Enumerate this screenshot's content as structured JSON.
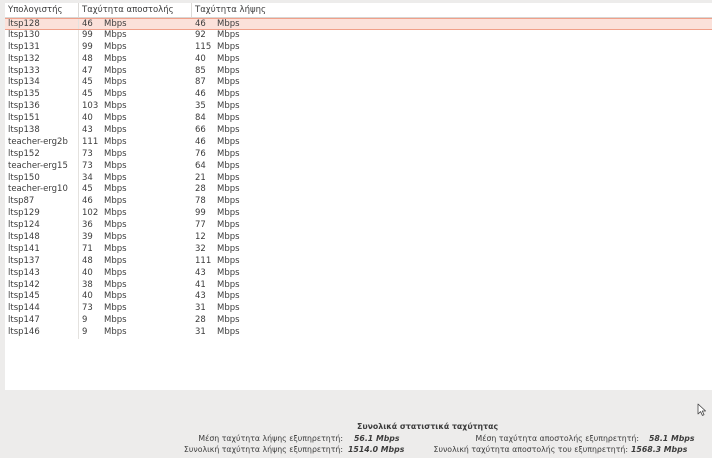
{
  "table": {
    "columns": [
      "Υπολογιστής",
      "Ταχύτητα αποστολής",
      "Ταχύτητα λήψης"
    ],
    "unit": "Mbps",
    "selected_index": 0,
    "rows": [
      {
        "host": "ltsp128",
        "send": "46",
        "recv": "46"
      },
      {
        "host": "ltsp130",
        "send": "99",
        "recv": "92"
      },
      {
        "host": "ltsp131",
        "send": "99",
        "recv": "115"
      },
      {
        "host": "ltsp132",
        "send": "48",
        "recv": "40"
      },
      {
        "host": "ltsp133",
        "send": "47",
        "recv": "85"
      },
      {
        "host": "ltsp134",
        "send": "45",
        "recv": "87"
      },
      {
        "host": "ltsp135",
        "send": "45",
        "recv": "46"
      },
      {
        "host": "ltsp136",
        "send": "103",
        "recv": "35"
      },
      {
        "host": "ltsp151",
        "send": "40",
        "recv": "84"
      },
      {
        "host": "ltsp138",
        "send": "43",
        "recv": "66"
      },
      {
        "host": "teacher-erg2b",
        "send": "111",
        "recv": "46"
      },
      {
        "host": "ltsp152",
        "send": "73",
        "recv": "76"
      },
      {
        "host": "teacher-erg15",
        "send": "73",
        "recv": "64"
      },
      {
        "host": "ltsp150",
        "send": "34",
        "recv": "21"
      },
      {
        "host": "teacher-erg10",
        "send": "45",
        "recv": "28"
      },
      {
        "host": "ltsp87",
        "send": "46",
        "recv": "78"
      },
      {
        "host": "ltsp129",
        "send": "102",
        "recv": "99"
      },
      {
        "host": "ltsp124",
        "send": "36",
        "recv": "77"
      },
      {
        "host": "ltsp148",
        "send": "39",
        "recv": "12"
      },
      {
        "host": "ltsp141",
        "send": "71",
        "recv": "32"
      },
      {
        "host": "ltsp137",
        "send": "48",
        "recv": "111"
      },
      {
        "host": "ltsp143",
        "send": "40",
        "recv": "43"
      },
      {
        "host": "ltsp142",
        "send": "38",
        "recv": "41"
      },
      {
        "host": "ltsp145",
        "send": "40",
        "recv": "43"
      },
      {
        "host": "ltsp144",
        "send": "73",
        "recv": "31"
      },
      {
        "host": "ltsp147",
        "send": "9",
        "recv": "28"
      },
      {
        "host": "ltsp146",
        "send": "9",
        "recv": "31"
      }
    ]
  },
  "stats": {
    "title": "Συνολικά στατιστικά ταχύτητας",
    "avg_recv_label": "Μέση ταχύτητα λήψης εξυπηρετητή:",
    "avg_recv_value": "56.1 Mbps",
    "avg_send_label": "Μέση ταχύτητα αποστολής εξυπηρετητή:",
    "avg_send_value": "58.1 Mbps",
    "total_recv_label": "Συνολική ταχύτητα λήψης εξυπηρετητή:",
    "total_recv_value": "1514.0 Mbps",
    "total_send_label": "Συνολική ταχύτητα αποστολής του εξυπηρετητή:",
    "total_send_value": "1568.3 Mbps"
  },
  "colors": {
    "selection_bg": "#fbe1da",
    "selection_border": "#f0a08a",
    "window_bg": "#edeceb"
  },
  "icons": {
    "cursor": "mouse-pointer-icon"
  }
}
